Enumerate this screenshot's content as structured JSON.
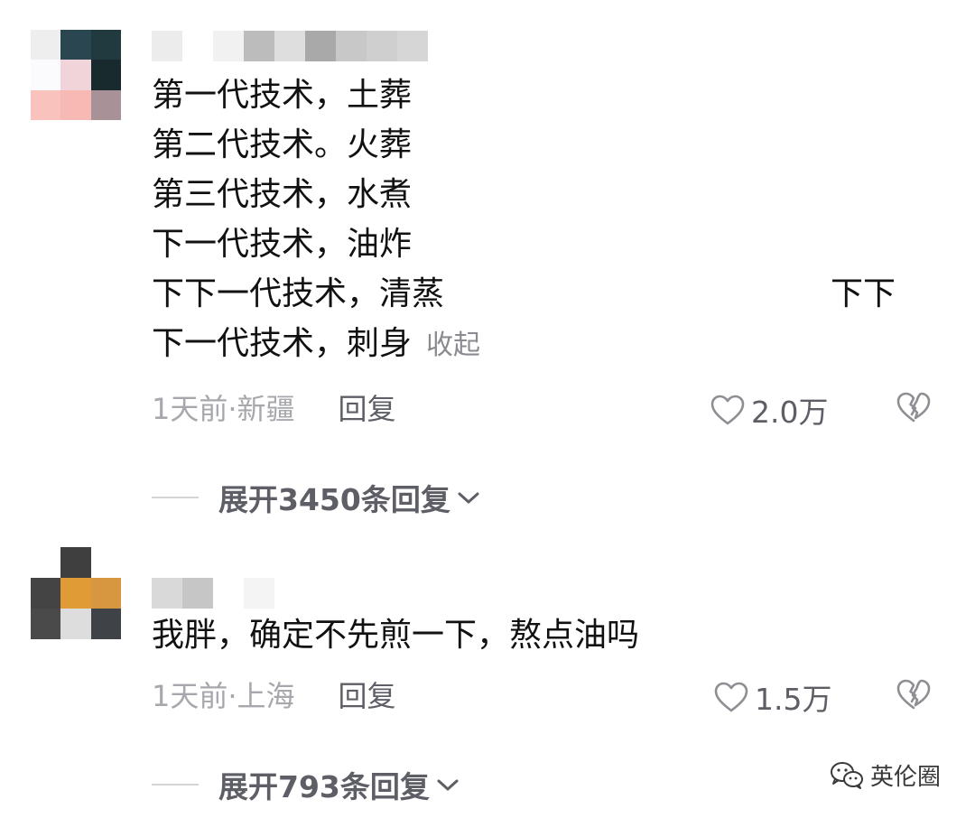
{
  "comments": [
    {
      "avatar_colors": [
        "#eeeeee",
        "#2a4650",
        "#203a40",
        "#fbfbfd",
        "#f0d4d9",
        "#182a2e",
        "#f9c2bd",
        "#f6b9b4",
        "#a89297"
      ],
      "username_colors": [
        "#ececec",
        "#ffffff",
        "#f1f1f1",
        "#bcbcbc",
        "#dedede",
        "#a9a9a9",
        "#c8c8c8",
        "#cfcfcf",
        "#d6d6d6"
      ],
      "lines": [
        "第一代技术，土葬",
        "第二代技术。火葬",
        "第三代技术，水煮",
        "下一代技术，油炸",
        "下下一代技术，清蒸",
        "下一代技术，刺身"
      ],
      "tail_text": "下下",
      "collapse_label": "收起",
      "time_location": "1天前·新疆",
      "reply_label": "回复",
      "likes": "2.0万",
      "expand_label": "展开3450条回复"
    },
    {
      "avatar_colors": [
        "#ffffff",
        "#3f3f3f",
        "#ffffff",
        "#444444",
        "#e09a36",
        "#d69740",
        "#4a4a4a",
        "#dddddd",
        "#3f4246"
      ],
      "username_colors": [
        "#d9d9d9",
        "#c6c6c6",
        "#ffffff",
        "#f4f4f4"
      ],
      "lines": [
        "我胖，确定不先煎一下，熬点油吗"
      ],
      "time_location": "1天前·上海",
      "reply_label": "回复",
      "likes": "1.5万",
      "expand_label": "展开793条回复"
    }
  ],
  "watermark": {
    "text": "英伦圈",
    "icon": "wechat-icon"
  },
  "colors": {
    "text": "#111111",
    "meta": "#a7a8ad",
    "action": "#5e5f66"
  }
}
